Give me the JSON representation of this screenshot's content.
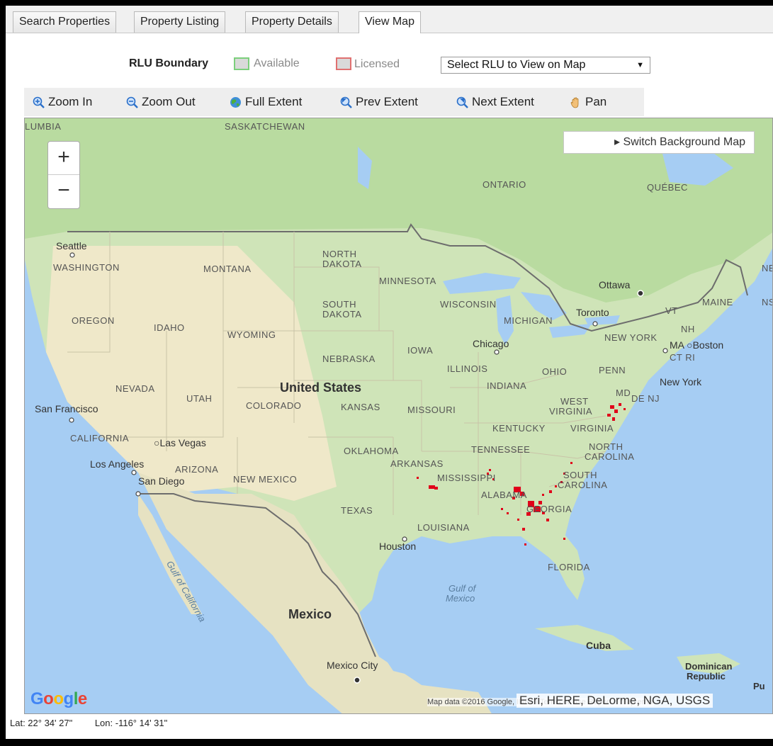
{
  "tabs": [
    {
      "label": "Search Properties"
    },
    {
      "label": "Property Listing"
    },
    {
      "label": "Property Details"
    },
    {
      "label": "View Map",
      "active": true
    }
  ],
  "legend": {
    "title": "RLU Boundary",
    "available": "Available",
    "licensed": "Licensed",
    "available_color": "#7ccf7c",
    "licensed_color": "#e07070"
  },
  "rlu_select": {
    "value": "Select RLU to View on Map"
  },
  "toolbar": {
    "zoom_in": "Zoom In",
    "zoom_out": "Zoom Out",
    "full_extent": "Full Extent",
    "prev_extent": "Prev Extent",
    "next_extent": "Next Extent",
    "pan": "Pan"
  },
  "map": {
    "zoom_in_label": "+",
    "zoom_out_label": "−",
    "switch_background": "▸ Switch Background Map",
    "google_logo": "Google",
    "attribution": "Map data ©2016 Google, INEGI   Terms of Use   Report a map error",
    "esri_credit": "Esri, HERE, DeLorme, NGA, USGS",
    "labels": {
      "columbia": "LUMBIA",
      "saskatchewan": "SASKATCHEWAN",
      "ontario": "ONTARIO",
      "quebec": "QUÉBEC",
      "ne_edge": "NE",
      "seattle": "Seattle",
      "washington": "WASHINGTON",
      "montana": "MONTANA",
      "north_dakota_1": "NORTH",
      "north_dakota_2": "DAKOTA",
      "minnesota": "MINNESOTA",
      "ottawa": "Ottawa",
      "oregon": "OREGON",
      "idaho": "IDAHO",
      "wyoming": "WYOMING",
      "south_dakota_1": "SOUTH",
      "south_dakota_2": "DAKOTA",
      "wisconsin": "WISCONSIN",
      "michigan": "MICHIGAN",
      "toronto": "Toronto",
      "vt": "VT",
      "maine": "MAINE",
      "nh": "NH",
      "ns_edge": "NS",
      "new_york": "NEW YORK",
      "ma_boston": "MA ○Boston",
      "ct_ri": "CT RI",
      "chicago": "Chicago",
      "iowa": "IOWA",
      "nebraska": "NEBRASKA",
      "illinois": "ILLINOIS",
      "ohio": "OHIO",
      "penn": "PENN",
      "nevada": "NEVADA",
      "utah": "UTAH",
      "united_states": "United States",
      "indiana": "INDIANA",
      "new_york_city": "New York",
      "md": "MD",
      "de_nj": "DE NJ",
      "colorado": "COLORADO",
      "kansas": "KANSAS",
      "missouri": "MISSOURI",
      "west_virginia_1": "WEST",
      "west_virginia_2": "VIRGINIA",
      "san_francisco": "San Francisco",
      "kentucky": "KENTUCKY",
      "virginia": "VIRGINIA",
      "california": "CALIFORNIA",
      "las_vegas": "○Las Vegas",
      "oklahoma": "OKLAHOMA",
      "tennessee": "TENNESSEE",
      "north_carolina_1": "NORTH",
      "north_carolina_2": "CAROLINA",
      "los_angeles": "Los Angeles",
      "arizona": "ARIZONA",
      "arkansas": "ARKANSAS",
      "south_carolina_1": "SOUTH",
      "south_carolina_2": "CAROLINA",
      "san_diego": "San Diego",
      "new_mexico": "NEW MEXICO",
      "mississippi": "MISSISSIPPI",
      "alabama": "ALABAMA",
      "georgia": "GEORGIA",
      "texas": "TEXAS",
      "louisiana": "LOUISIANA",
      "houston": "Houston",
      "florida": "FLORIDA",
      "gulf_california": "Gulf of California",
      "gulf_mexico_1": "Gulf of",
      "gulf_mexico_2": "Mexico",
      "mexico": "Mexico",
      "cuba": "Cuba",
      "mexico_city": "Mexico City",
      "dominican_1": "Dominican",
      "dominican_2": "Republic",
      "pu_edge": "Pu"
    },
    "marker_color": "#e0001a"
  },
  "coordinates": {
    "lat": "Lat:  22° 34' 27\"",
    "lon": "Lon:  -116° 14' 31\""
  }
}
